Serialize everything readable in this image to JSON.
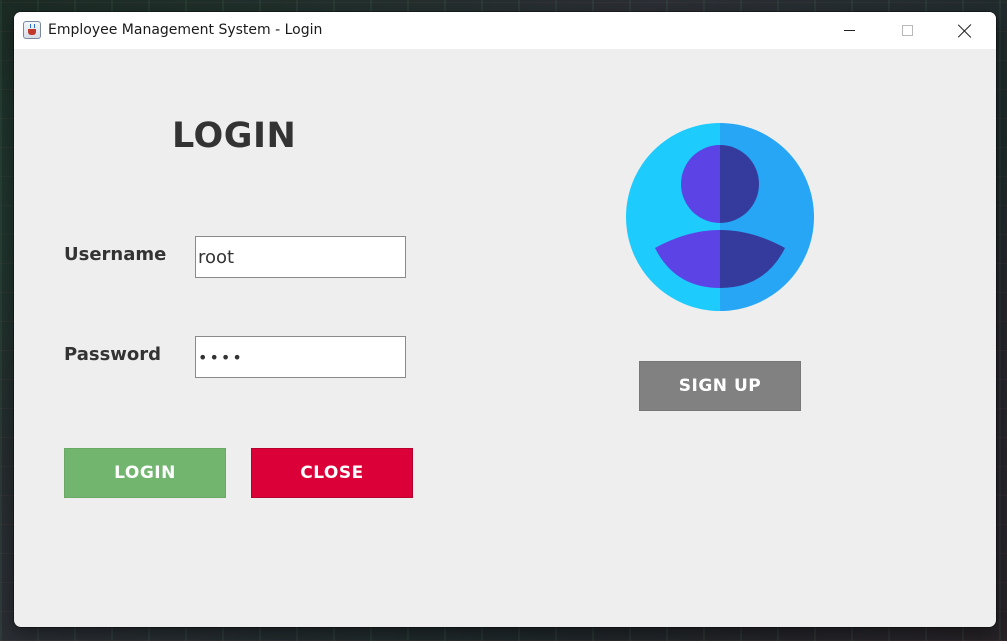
{
  "window": {
    "title": "Employee Management System - Login",
    "icon": "java-cup-icon"
  },
  "login_form": {
    "heading": "LOGIN",
    "username_label": "Username",
    "username_value": "root",
    "password_label": "Password",
    "password_value": "••••"
  },
  "buttons": {
    "login_label": "LOGIN",
    "close_label": "CLOSE",
    "signup_label": "SIGN UP"
  },
  "avatar": {
    "icon": "user-avatar-icon"
  },
  "colors": {
    "login_button": "#72b56e",
    "close_button": "#dc0038",
    "signup_button": "#818181",
    "avatar_light_blue": "#1ecbfd",
    "avatar_blue": "#27a6f5",
    "avatar_person_light": "#5c43e6",
    "avatar_person_dark": "#353b9c",
    "window_background": "#eeeeee"
  }
}
